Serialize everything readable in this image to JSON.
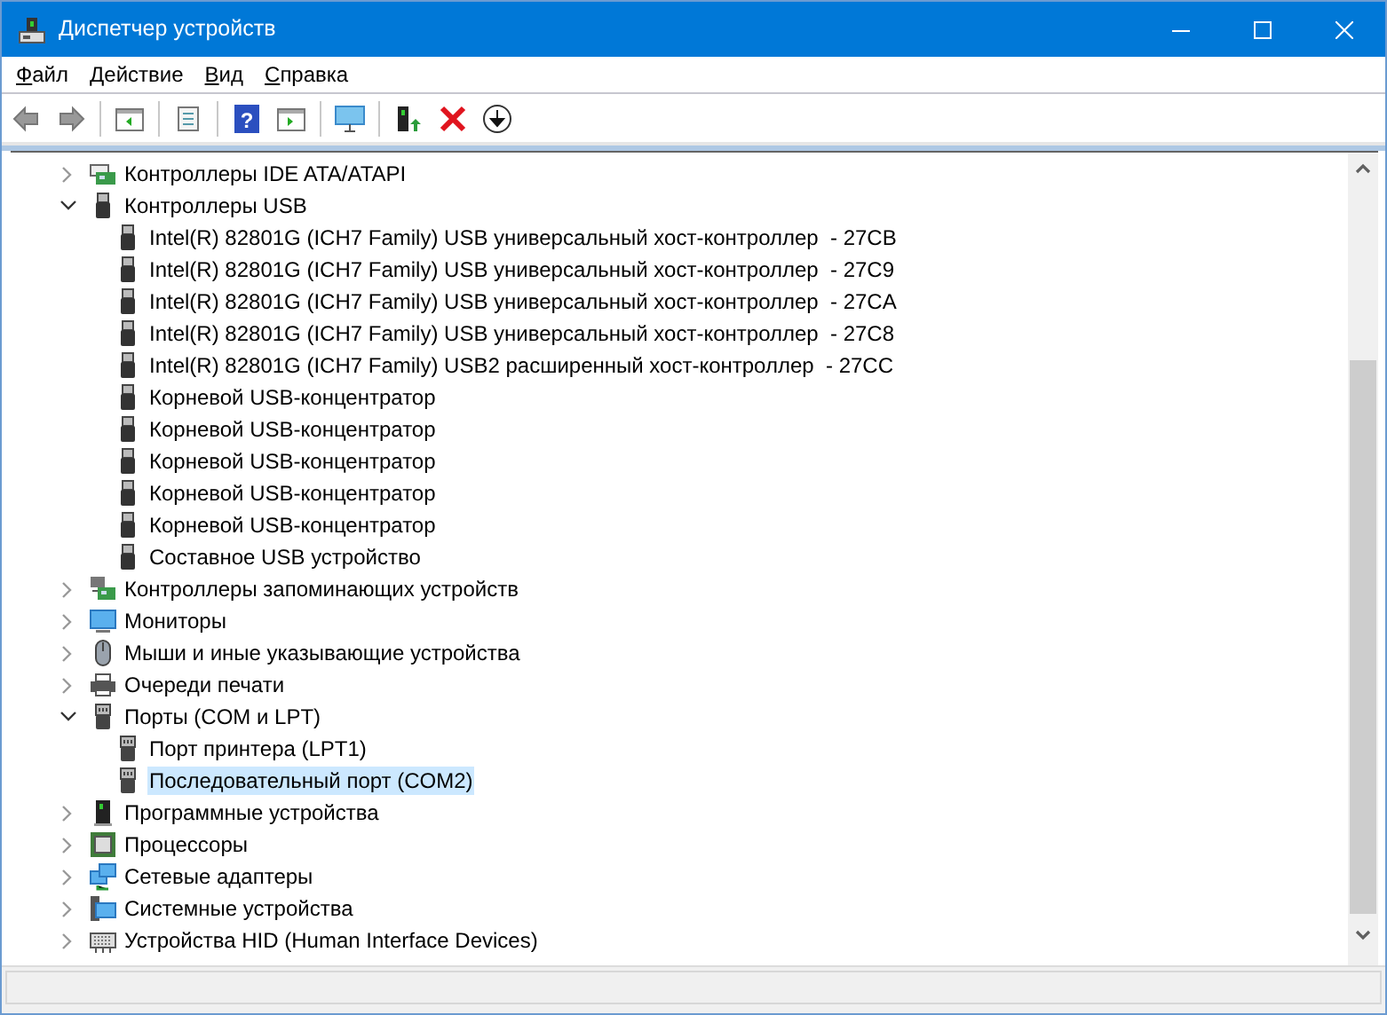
{
  "window": {
    "title": "Диспетчер устройств"
  },
  "menu": [
    "Файл",
    "Действие",
    "Вид",
    "Справка"
  ],
  "toolbar": {
    "help_glyph": "?"
  },
  "tree": [
    {
      "label": "Контроллеры IDE ATA/ATAPI",
      "expanded": false,
      "selected": false
    },
    {
      "label": "Контроллеры USB",
      "expanded": true,
      "selected": false,
      "children": [
        {
          "label": "Intel(R) 82801G (ICH7 Family) USB универсальный хост-контроллер  - 27CB",
          "selected": false
        },
        {
          "label": "Intel(R) 82801G (ICH7 Family) USB универсальный хост-контроллер  - 27C9",
          "selected": false
        },
        {
          "label": "Intel(R) 82801G (ICH7 Family) USB универсальный хост-контроллер  - 27CA",
          "selected": false
        },
        {
          "label": "Intel(R) 82801G (ICH7 Family) USB универсальный хост-контроллер  - 27C8",
          "selected": false
        },
        {
          "label": "Intel(R) 82801G (ICH7 Family) USB2 расширенный хост-контроллер  - 27CC",
          "selected": false
        },
        {
          "label": "Корневой USB-концентратор",
          "selected": false
        },
        {
          "label": "Корневой USB-концентратор",
          "selected": false
        },
        {
          "label": "Корневой USB-концентратор",
          "selected": false
        },
        {
          "label": "Корневой USB-концентратор",
          "selected": false
        },
        {
          "label": "Корневой USB-концентратор",
          "selected": false
        },
        {
          "label": "Составное USB устройство",
          "selected": false
        }
      ]
    },
    {
      "label": "Контроллеры запоминающих устройств",
      "expanded": false,
      "selected": false
    },
    {
      "label": "Мониторы",
      "expanded": false,
      "selected": false
    },
    {
      "label": "Мыши и иные указывающие устройства",
      "expanded": false,
      "selected": false
    },
    {
      "label": "Очереди печати",
      "expanded": false,
      "selected": false
    },
    {
      "label": "Порты (COM и LPT)",
      "expanded": true,
      "selected": false,
      "children": [
        {
          "label": "Порт принтера (LPT1)",
          "selected": false
        },
        {
          "label": "Последовательный порт (COM2)",
          "selected": true
        }
      ]
    },
    {
      "label": "Программные устройства",
      "expanded": false,
      "selected": false
    },
    {
      "label": "Процессоры",
      "expanded": false,
      "selected": false
    },
    {
      "label": "Сетевые адаптеры",
      "expanded": false,
      "selected": false
    },
    {
      "label": "Системные устройства",
      "expanded": false,
      "selected": false
    },
    {
      "label": "Устройства HID (Human Interface Devices)",
      "expanded": false,
      "selected": false
    }
  ]
}
